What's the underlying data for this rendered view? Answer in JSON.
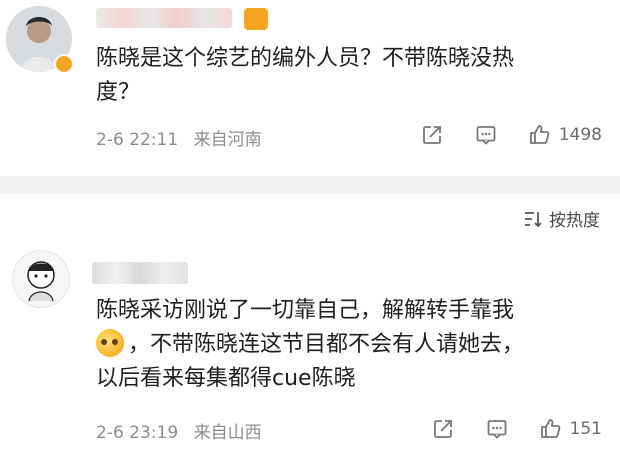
{
  "comments": [
    {
      "text_lines": [
        "陈晓是这个综艺的编外人员？不带陈晓没热",
        "度？"
      ],
      "date": "2-6 22:11",
      "location": "来自河南",
      "like_count": "1498"
    },
    {
      "text_lines": [
        "陈晓采访刚说了一切靠自己，解解转手靠我",
        "，不带陈晓连这节目都不会有人请她去，",
        "以后看来每集都得cue陈晓"
      ],
      "date": "2-6 23:19",
      "location": "来自山西",
      "like_count": "151"
    }
  ],
  "sort_label": "按热度",
  "icons": {
    "share": "share-icon",
    "comment": "comment-icon",
    "like": "thumbs-up-icon",
    "sort": "sort-icon",
    "verified": "verified-badge-icon",
    "crown": "crown-icon",
    "emoji": "blush-emoji-icon"
  },
  "colors": {
    "text": "#1f1f1f",
    "meta": "#8c8c8c",
    "divider": "#f2f2f2",
    "badge": "#f6a623"
  }
}
